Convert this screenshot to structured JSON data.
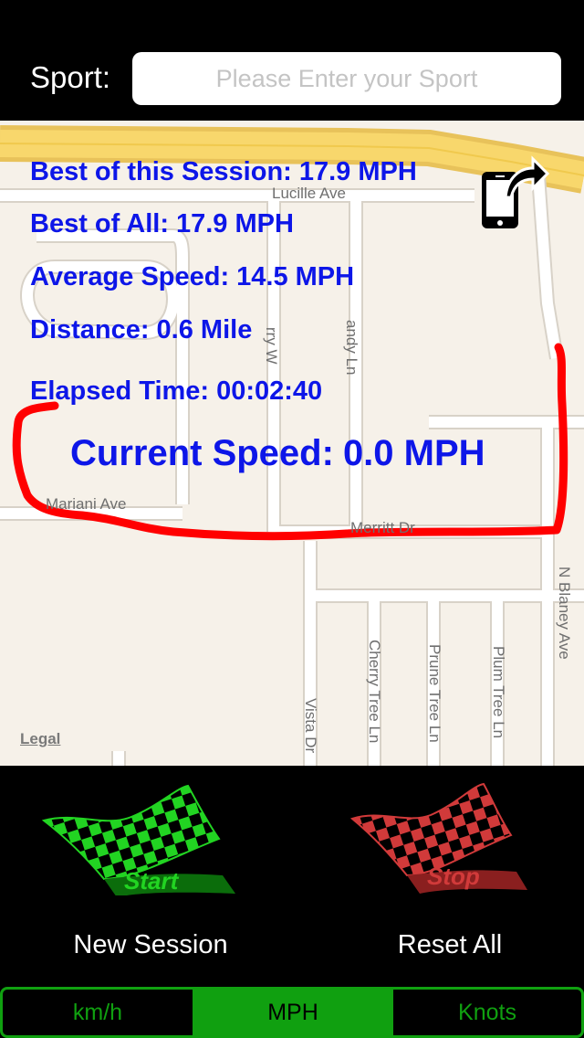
{
  "header": {
    "sport_label": "Sport:",
    "sport_placeholder": "Please Enter your Sport",
    "sport_value": ""
  },
  "map": {
    "streets": {
      "lucille": "Lucille Ave",
      "mariani": "Mariani Ave",
      "merritt": "Merritt Dr",
      "blaney": "N Blaney Ave",
      "cherry": "Cherry Tree Ln",
      "prune": "Prune Tree Ln",
      "plum": "Plum Tree Ln",
      "vista": "Vista Dr",
      "andy": "andy Ln",
      "rry": "rry W"
    },
    "legal": "Legal"
  },
  "stats": {
    "best_session_label": "Best of this Session:",
    "best_session_value": "17.9 MPH",
    "best_all_label": "Best of All:",
    "best_all_value": "17.9 MPH",
    "avg_label": "Average Speed:",
    "avg_value": "14.5 MPH",
    "distance_label": "Distance:",
    "distance_value": "0.6 Mile",
    "elapsed_label": "Elapsed Time:",
    "elapsed_value": "00:02:40",
    "current_label": "Current Speed:",
    "current_value": "0.0 MPH"
  },
  "controls": {
    "start_flag_text": "Start",
    "stop_flag_text": "Stop",
    "new_session": "New Session",
    "reset_all": "Reset All"
  },
  "units": {
    "tabs": [
      "km/h",
      "MPH",
      "Knots"
    ],
    "selected": "MPH"
  },
  "colors": {
    "stat_text": "#0d16e8",
    "route": "#ff0000",
    "start_flag": "#22d422",
    "stop_flag": "#d13a3a",
    "tab_accent": "#10a010",
    "highway": "#f5c842"
  },
  "icons": {
    "share": "phone-share-icon",
    "start": "checkered-flag-icon",
    "stop": "checkered-flag-icon"
  }
}
